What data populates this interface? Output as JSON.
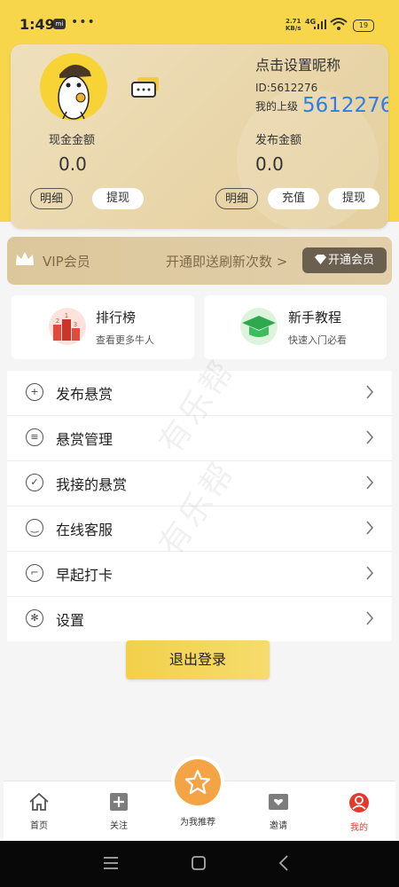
{
  "status": {
    "time": "1:49",
    "net_speed": "2.71",
    "net_unit": "KB/s",
    "signal": "4G",
    "battery": "19"
  },
  "profile": {
    "nickname_prompt": "点击设置昵称",
    "id_text": "ID:5612276",
    "upline_label": "我的上级",
    "upline_value": "5612276"
  },
  "cash": {
    "label": "现金金额",
    "amount": "0.0",
    "detail_btn": "明细",
    "withdraw_btn": "提现"
  },
  "publish": {
    "label": "发布金额",
    "amount": "0.0",
    "detail_btn": "明细",
    "recharge_btn": "充值",
    "withdraw_btn": "提现"
  },
  "vip": {
    "title": "VIP会员",
    "desc": "开通即送刷新次数 >",
    "button": "开通会员"
  },
  "tiles": [
    {
      "title": "排行榜",
      "subtitle": "查看更多牛人"
    },
    {
      "title": "新手教程",
      "subtitle": "快速入门必看"
    }
  ],
  "menu": [
    {
      "label": "发布悬赏",
      "icon": "plus-circle-icon"
    },
    {
      "label": "悬赏管理",
      "icon": "list-circle-icon"
    },
    {
      "label": "我接的悬赏",
      "icon": "check-circle-icon"
    },
    {
      "label": "在线客服",
      "icon": "smile-circle-icon"
    },
    {
      "label": "早起打卡",
      "icon": "clock-circle-icon"
    },
    {
      "label": "设置",
      "icon": "gear-icon"
    }
  ],
  "watermark": "有乐帮",
  "logout": "退出登录",
  "tabbar": {
    "home": "首页",
    "follow": "关注",
    "recommend": "为我推荐",
    "invite": "邀请",
    "mine": "我的"
  },
  "colors": {
    "accent": "#f7d64c",
    "active_tab": "#e23b2e",
    "upline": "#2d7fe6",
    "vip_btn": "#6b5f4f",
    "fab": "#f4a444"
  }
}
